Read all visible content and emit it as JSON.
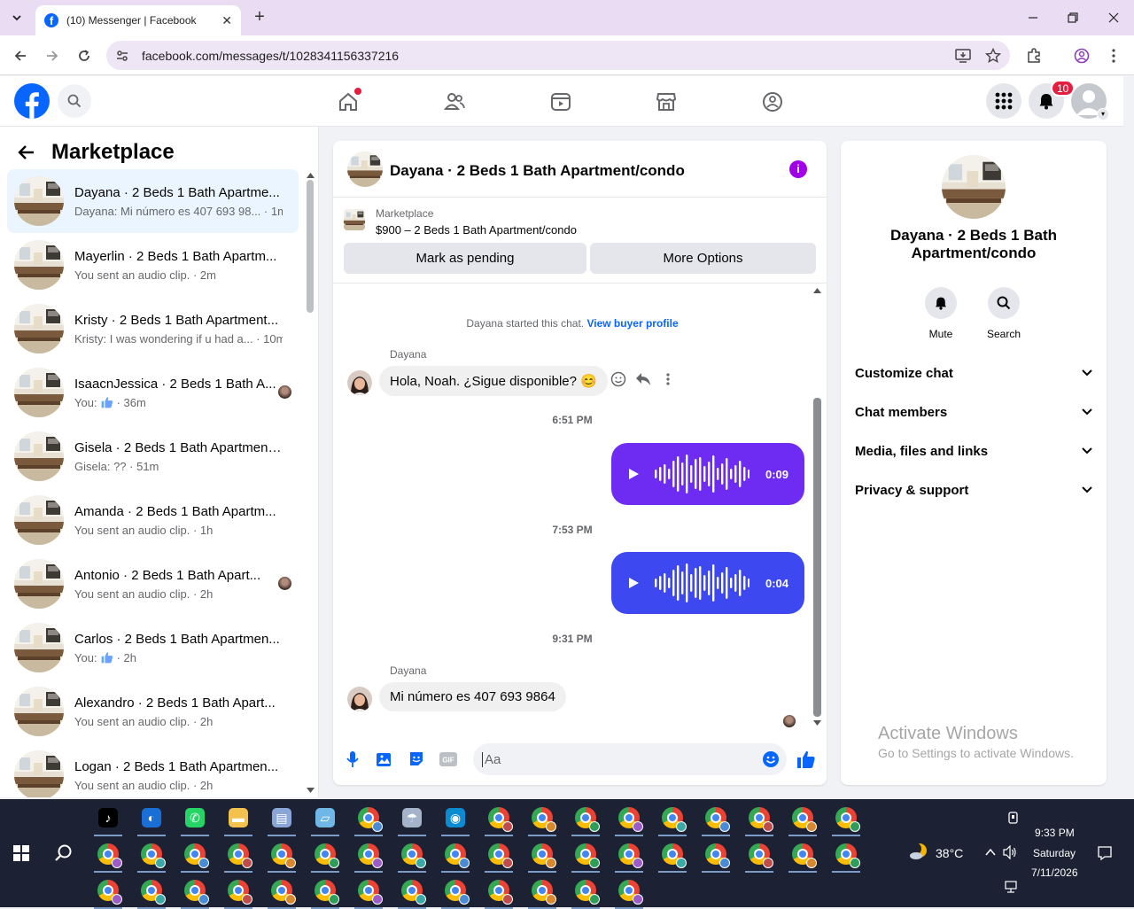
{
  "browser": {
    "tab_title": "(10) Messenger | Facebook",
    "url": "facebook.com/messages/t/1028341156337216"
  },
  "fb": {
    "notif_count": "10"
  },
  "sidebar": {
    "title": "Marketplace",
    "conversations": [
      {
        "name": "Dayana · 2 Beds 1 Bath Apartme...",
        "preview": "Dayana: Mi número es 407 693 98... · 1m",
        "active": true
      },
      {
        "name": "Mayerlin · 2 Beds 1 Bath Apartm...",
        "preview": "You sent an audio clip. · 2m"
      },
      {
        "name": "Kristy · 2 Beds 1 Bath Apartment...",
        "preview": "Kristy: I was wondering if u had a... · 10m"
      },
      {
        "name": "IsaacnJessica · 2 Beds 1 Bath A...",
        "preview_prefix": "You:",
        "preview_suffix": "· 36m",
        "seen": true
      },
      {
        "name": "Gisela · 2 Beds 1 Bath Apartment...",
        "preview": "Gisela: ?? · 51m"
      },
      {
        "name": "Amanda · 2 Beds 1 Bath Apartm...",
        "preview": "You sent an audio clip. · 1h"
      },
      {
        "name": "Antonio · 2 Beds 1 Bath Apart...",
        "preview": "You sent an audio clip. · 2h",
        "seen": true
      },
      {
        "name": "Carlos · 2 Beds 1 Bath Apartmen...",
        "preview_prefix": "You:",
        "preview_suffix": "· 2h"
      },
      {
        "name": "Alexandro · 2 Beds 1 Bath Apart...",
        "preview": "You sent an audio clip. · 2h"
      },
      {
        "name": "Logan · 2 Beds 1 Bath Apartmen...",
        "preview": "You sent an audio clip. · 2h"
      }
    ]
  },
  "chat": {
    "title": "Dayana · 2 Beds 1 Bath Apartment/condo",
    "marketplace_label": "Marketplace",
    "listing": "$900 – 2 Beds 1 Bath Apartment/condo",
    "mark_pending": "Mark as pending",
    "more_options": "More Options",
    "system_text": "Dayana started this chat.",
    "buyer_link": "View buyer profile",
    "sender1": "Dayana",
    "msg1": "Hola, Noah. ¿Sigue disponible? 😊",
    "time1": "6:51 PM",
    "audio1": "0:09",
    "time2": "7:53 PM",
    "audio2": "0:04",
    "time3": "9:31 PM",
    "sender2": "Dayana",
    "msg2": "Mi número es 407 693 9864",
    "input_placeholder": "Aa"
  },
  "rpanel": {
    "name": "Dayana · 2 Beds 1 Bath Apartment/condo",
    "mute": "Mute",
    "search": "Search",
    "rows": [
      "Customize chat",
      "Chat members",
      "Media, files and links",
      "Privacy & support"
    ]
  },
  "windows": {
    "activate_title": "Activate Windows",
    "activate_sub": "Go to Settings to activate Windows."
  },
  "tray": {
    "temp": "38°C",
    "time": "9:33 PM",
    "day": "Saturday",
    "date": "7/11/2026"
  },
  "colors": {
    "fb_blue": "#0866ff",
    "audio1": "#6e2cf3",
    "audio2": "#3d48f0",
    "taskbar": "#1c2233"
  }
}
